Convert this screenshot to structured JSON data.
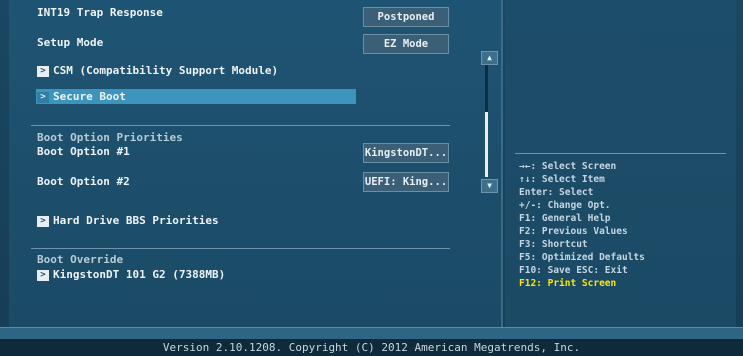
{
  "menu": {
    "int19_label": "INT19 Trap Response",
    "int19_value": "Postponed",
    "setup_mode_label": "Setup Mode",
    "setup_mode_value": "EZ Mode",
    "csm_label": "CSM (Compatibility Support Module)",
    "secure_boot_label": "Secure Boot",
    "boot_priorities_heading": "Boot Option Priorities",
    "boot1_label": "Boot Option #1",
    "boot1_value": "KingstonDT...",
    "boot2_label": "Boot Option #2",
    "boot2_value": "UEFI: King...",
    "hdd_bbs_label": "Hard Drive BBS Priorities",
    "boot_override_heading": "Boot Override",
    "override1_label": "KingstonDT 101 G2  (7388MB)"
  },
  "icons": {
    "submenu_arrow": ">",
    "scroll_up": "▲",
    "scroll_down": "▼"
  },
  "help": {
    "line1": "→←: Select Screen",
    "line2": "↑↓: Select Item",
    "line3": "Enter: Select",
    "line4": "+/-: Change Opt.",
    "line5": "F1: General Help",
    "line6": "F2: Previous Values",
    "line7": "F3: Shortcut",
    "line8": "F5: Optimized Defaults",
    "line9": "F10: Save  ESC: Exit",
    "line10": "F12: Print Screen"
  },
  "footer": {
    "version_text": "Version 2.10.1208. Copyright (C) 2012 American Megatrends, Inc."
  },
  "colors": {
    "highlight": "#3d94bd",
    "f12_text": "#ffe500",
    "background": "#1d4f6c"
  }
}
